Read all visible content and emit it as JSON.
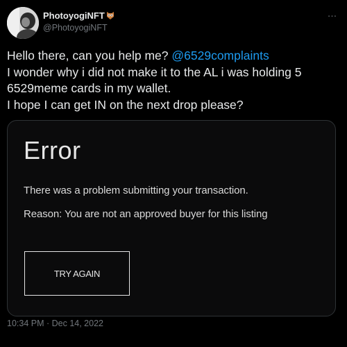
{
  "author": {
    "display_name": "PhotoyogiNFT",
    "handle": "@PhotoyogiNFT",
    "name_emoji": "owl-emoji"
  },
  "tweet": {
    "line1_prefix": "Hello there, can you help me? ",
    "mention": "@6529complaints",
    "line2": "I wonder why i did not make it to the AL i was holding 5 6529meme cards in my wallet.",
    "line3": "I hope I can get IN on the next drop please?"
  },
  "error_card": {
    "title": "Error",
    "message": "There was a problem submitting your transaction.",
    "reason": "Reason: You are not an approved buyer for this listing",
    "button_label": "TRY AGAIN"
  },
  "more_icon": "…",
  "timestamp": "10:34 PM · Dec 14, 2022",
  "colors": {
    "background": "#000000",
    "text": "#e7e9ea",
    "secondary": "#71767b",
    "accent": "#1d9bf0",
    "card_border": "#2f3336"
  }
}
